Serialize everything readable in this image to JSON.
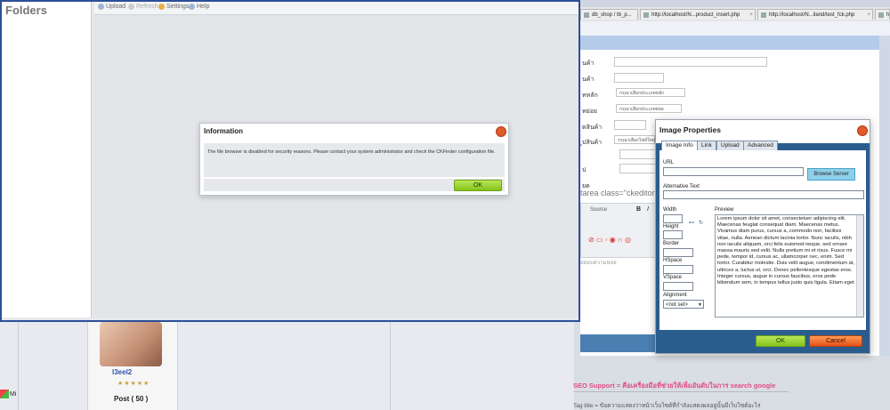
{
  "ckfinder": {
    "folders_title": "Folders",
    "toolbar": [
      {
        "label": "Upload",
        "icon": "upload-icon"
      },
      {
        "label": "Refresh",
        "icon": "refresh-icon"
      },
      {
        "label": "Settings",
        "icon": "settings-icon"
      },
      {
        "label": "Help",
        "icon": "help-icon"
      }
    ],
    "info_dialog": {
      "title": "Information",
      "message": "The file browser is disabled for security reasons. Please contact your system administrator and check the CKFinder configuration file.",
      "ok_label": "OK"
    }
  },
  "browser": {
    "tabs": [
      {
        "label": "db_shop / tb_p..."
      },
      {
        "label": "http://localhost/N...product_insert.php"
      },
      {
        "label": "http://localhost/N...iland/test_fck.php"
      },
      {
        "label": "h"
      }
    ]
  },
  "form": {
    "labels": [
      "นค้า",
      "นค้า",
      "ทหลัก",
      "ทย่อย",
      "ดสินค้า",
      "ูปสินค้า",
      "ป",
      "ยด"
    ],
    "select_main": "กรุณาเลือกประเภทหลัก",
    "select_sub": "กรุณาเลือกประเภทย่อย",
    "select_image": "กรุณาเลือกไฟล์ใหม่",
    "textarea_hint": "tarea class=\"ckeditor",
    "editor_source": "Source",
    "footer_hint": "ลสอบความหลอ"
  },
  "image_dialog": {
    "title": "Image Properties",
    "tabs": [
      {
        "label": "Image Info",
        "active": true
      },
      {
        "label": "Link",
        "active": false
      },
      {
        "label": "Upload",
        "active": false
      },
      {
        "label": "Advanced",
        "active": false
      }
    ],
    "url_label": "URL",
    "browse_label": "Browse Server",
    "alt_label": "Alternative Text",
    "width_label": "Width",
    "height_label": "Height",
    "border_label": "Border",
    "hspace_label": "HSpace",
    "vspace_label": "VSpace",
    "alignment_label": "Alignment",
    "alignment_value": "<not set>",
    "preview_label": "Preview",
    "preview_text": "Lorem ipsum dolor sit amet, consectetuer adipiscing elit. Maecenas feugiat consequat diam. Maecenas metus. Vivamus diam purus, cursus a, commodo non, facilisis vitae, nulla. Aenean dictum lacinia tortor. Nunc iaculis, nibh non iaculis aliquam, orci felis euismod neque, sed ornare massa mauris sed velit. Nulla pretium mi et risus. Fusce mi pede, tempor id, cursus ac, ullamcorper nec, enim. Sed tortor. Curabitur molestie. Duis velit augue, condimentum at, ultrices a, luctus ut, orci. Donec pellentesque egestas eros. Integer cursus, augue in cursus faucibus, eros pede bibendum sem, in tempus tellus justo quis ligula. Etiam eget",
    "ok_label": "OK",
    "cancel_label": "Cancel"
  },
  "forum": {
    "username": "l3eel2",
    "post_count": "Post ( 50 )"
  },
  "taskbar": {
    "start_label": "Mi"
  },
  "seo": {
    "heading": "SEO Support = คือเครื่องมือที่ช่วยให้เพิ่มอันดับในการ search google",
    "tag_line": "Tag title = ข้อความแสดงว่าหน้าเว็บไซต์ที่กำลังแสดงผลอยู่นั้นมีเว็บไซต์อะไร"
  }
}
